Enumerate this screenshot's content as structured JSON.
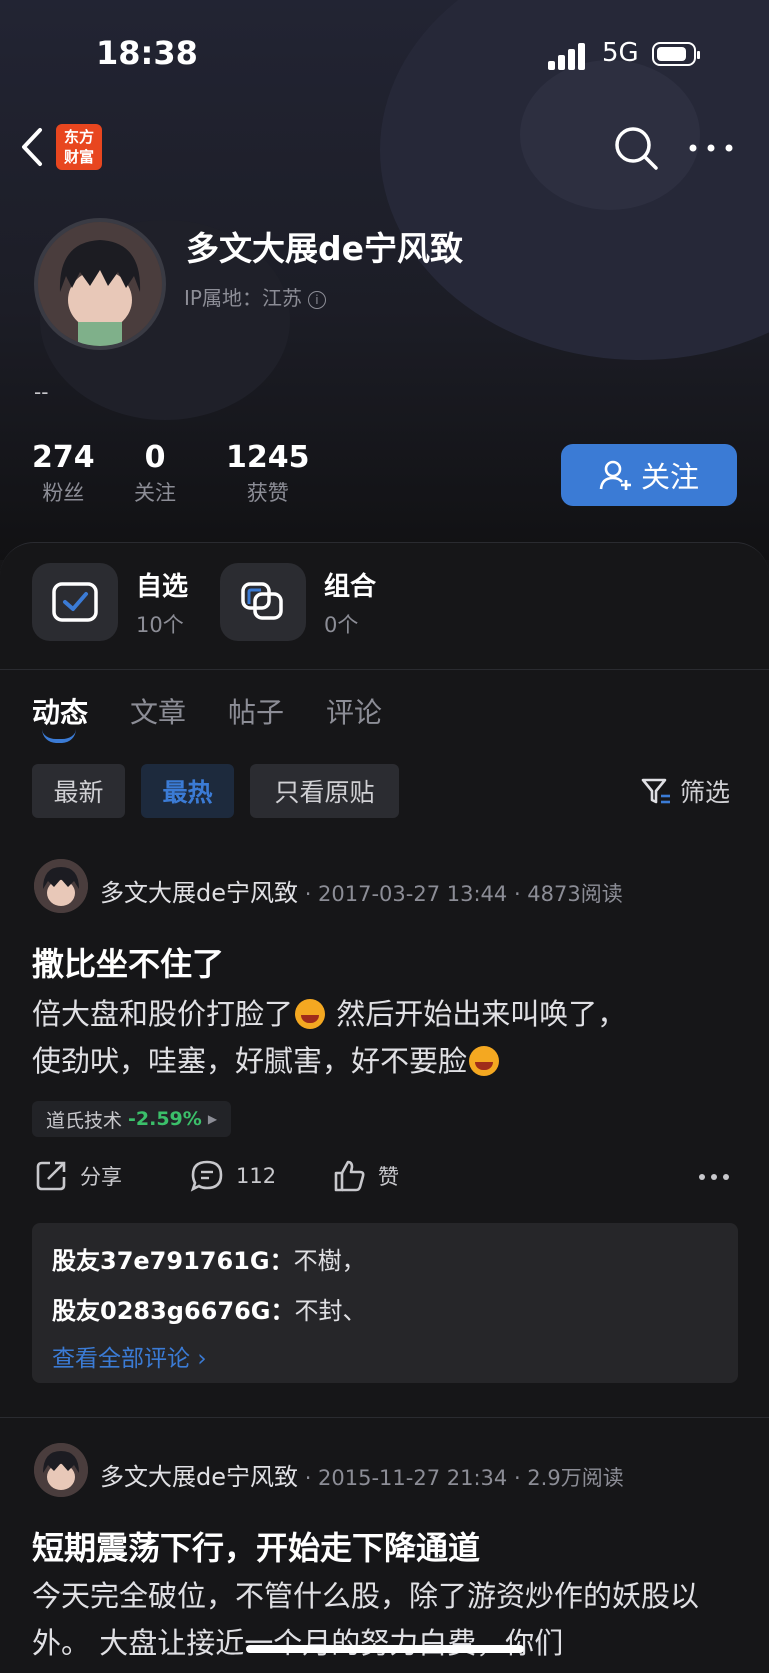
{
  "status_bar": {
    "time": "18:38",
    "network": "5G"
  },
  "nav": {
    "logo_line1": "东方",
    "logo_line2": "财富"
  },
  "profile": {
    "name": "多文大展de宁风致",
    "ip_label": "IP属地：江苏",
    "bio": "--",
    "stats": [
      {
        "value": "274",
        "label": "粉丝"
      },
      {
        "value": "0",
        "label": "关注"
      },
      {
        "value": "1245",
        "label": "获赞"
      }
    ],
    "follow_label": "关注"
  },
  "shortcuts": [
    {
      "title": "自选",
      "sub": "10个",
      "icon": "checkbox-icon"
    },
    {
      "title": "组合",
      "sub": "0个",
      "icon": "overlap-squares-icon"
    }
  ],
  "tabs": [
    "动态",
    "文章",
    "帖子",
    "评论"
  ],
  "filters": {
    "chips": [
      "最新",
      "最热",
      "只看原贴"
    ],
    "filter_label": "筛选"
  },
  "posts": [
    {
      "author": "多文大展de宁风致",
      "meta": "· 2017-03-27 13:44 · 4873阅读",
      "title": "撒比坐不住了",
      "body_p1": "倍大盘和股价打脸了",
      "body_p2": " 然后开始出来叫唤了，",
      "body_p3": "使劲吠，哇塞，好腻害，好不要脸",
      "stock_name": "道氏技术",
      "stock_pct": "-2.59%",
      "share": "分享",
      "comment_count": "112",
      "like": "赞",
      "comments": [
        {
          "user": "股友37e791761G：",
          "text": "不樹，"
        },
        {
          "user": "股友0283g6676G：",
          "text": "不封、"
        }
      ],
      "see_all": "查看全部评论"
    },
    {
      "author": "多文大展de宁风致",
      "meta": "· 2015-11-27 21:34 · 2.9万阅读",
      "title": "短期震荡下行，开始走下降通道",
      "body": "今天完全破位，不管什么股，除了游资炒作的妖股以外。 大盘让接近一个月的努力白费，你们"
    }
  ]
}
